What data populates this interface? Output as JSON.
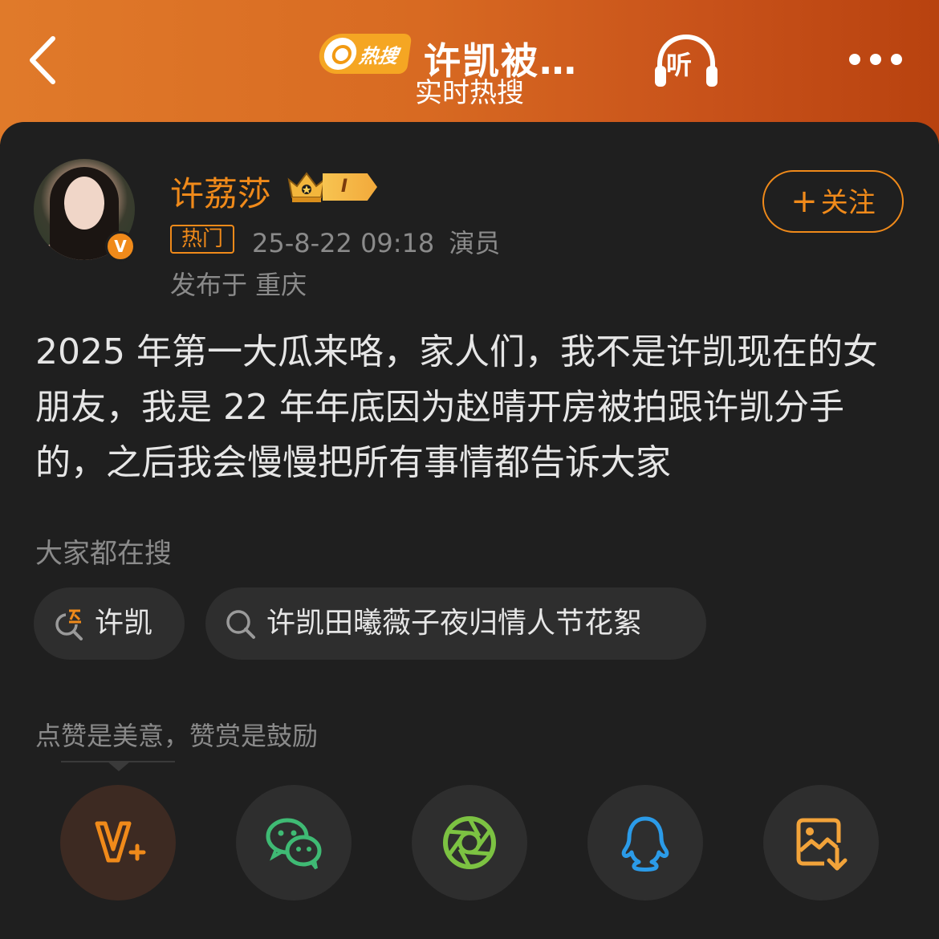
{
  "header": {
    "back_icon": "chevron-left-icon",
    "hot_search_badge": "热搜",
    "title": "许凯被…",
    "subtitle": "实时热搜",
    "listen_label": "听",
    "more_icon": "more-dots-icon",
    "background_gradient": [
      "#e07a2a",
      "#b8420f"
    ]
  },
  "post": {
    "author": {
      "name": "许荔莎",
      "level_badge": "I",
      "verified_badge": "V"
    },
    "follow_button": {
      "plus": "+",
      "label": "关注"
    },
    "hot_tag": "热门",
    "timestamp": "25-8-22 09:18",
    "role": "演员",
    "location": "发布于 重庆",
    "content": "2025 年第一大瓜来咯，家人们，我不是许凯现在的女朋友，我是 22 年年底因为赵晴开房被拍跟许凯分手的，之后我会慢慢把所有事情都告诉大家"
  },
  "search_section": {
    "label": "大家都在搜",
    "chips": [
      {
        "text": "许凯",
        "icon": "hot-search-icon"
      },
      {
        "text": "许凯田曦薇子夜归情人节花絮",
        "icon": "search-icon"
      }
    ]
  },
  "reward": {
    "text": "点赞是美意，赞赏是鼓励"
  },
  "share": {
    "buttons": [
      {
        "name": "vplus",
        "icon": "vplus-icon"
      },
      {
        "name": "wechat",
        "icon": "wechat-icon"
      },
      {
        "name": "moments",
        "icon": "moments-icon"
      },
      {
        "name": "qq",
        "icon": "qq-icon"
      },
      {
        "name": "save-image",
        "icon": "save-image-icon"
      }
    ]
  },
  "colors": {
    "accent": "#f08a1a",
    "card_bg": "#1f1f1f",
    "chip_bg": "#2e2e2e",
    "muted_text": "#8a8a8a",
    "wechat_green": "#3fba74",
    "moments_green": "#7cc242",
    "qq_blue": "#2b9be8",
    "save_orange": "#f2a33a"
  }
}
